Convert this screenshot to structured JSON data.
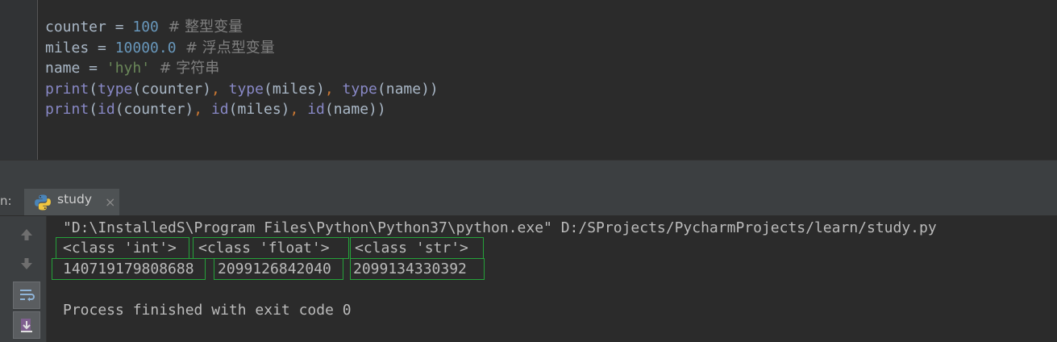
{
  "editor": {
    "lines": [
      [
        {
          "t": "counter = ",
          "c": "id"
        },
        {
          "t": "100",
          "c": "num"
        },
        {
          "t": "  # 整型变量",
          "c": "cmt"
        }
      ],
      [
        {
          "t": "miles = ",
          "c": "id"
        },
        {
          "t": "10000.0",
          "c": "num"
        },
        {
          "t": "  # 浮点型变量",
          "c": "cmt"
        }
      ],
      [
        {
          "t": "name = ",
          "c": "id"
        },
        {
          "t": "'hyh'",
          "c": "str"
        },
        {
          "t": "  # 字符串",
          "c": "cmt"
        }
      ],
      [
        {
          "t": "print",
          "c": "bi"
        },
        {
          "t": "(",
          "c": "id"
        },
        {
          "t": "type",
          "c": "bi"
        },
        {
          "t": "(counter)",
          "c": "id"
        },
        {
          "t": ", ",
          "c": "kw"
        },
        {
          "t": "type",
          "c": "bi"
        },
        {
          "t": "(miles)",
          "c": "id"
        },
        {
          "t": ", ",
          "c": "kw"
        },
        {
          "t": "type",
          "c": "bi"
        },
        {
          "t": "(name))",
          "c": "id"
        }
      ],
      [
        {
          "t": "print",
          "c": "bi"
        },
        {
          "t": "(",
          "c": "id"
        },
        {
          "t": "id",
          "c": "bi"
        },
        {
          "t": "(counter)",
          "c": "id"
        },
        {
          "t": ", ",
          "c": "kw"
        },
        {
          "t": "id",
          "c": "bi"
        },
        {
          "t": "(miles)",
          "c": "id"
        },
        {
          "t": ", ",
          "c": "kw"
        },
        {
          "t": "id",
          "c": "bi"
        },
        {
          "t": "(name))",
          "c": "id"
        }
      ]
    ]
  },
  "run_panel": {
    "label": "n:",
    "tab_label": "study",
    "tab_close": "×",
    "tab_icon": "python-icon"
  },
  "console": {
    "command": "\"D:\\InstalledS\\Program Files\\Python\\Python37\\python.exe\" D:/SProjects/PycharmProjects/learn/study.py",
    "types": [
      "<class 'int'>",
      "<class 'float'>",
      "<class 'str'>"
    ],
    "ids": [
      "140719179808688",
      "2099126842040",
      "2099134330392"
    ],
    "exit_message": "Process finished with exit code 0"
  },
  "side_buttons": [
    "up-arrow-icon",
    "down-arrow-icon",
    "soft-wrap-icon",
    "scroll-to-end-icon"
  ],
  "colors": {
    "highlight_box": "#25a23a",
    "background": "#2b2b2b"
  }
}
